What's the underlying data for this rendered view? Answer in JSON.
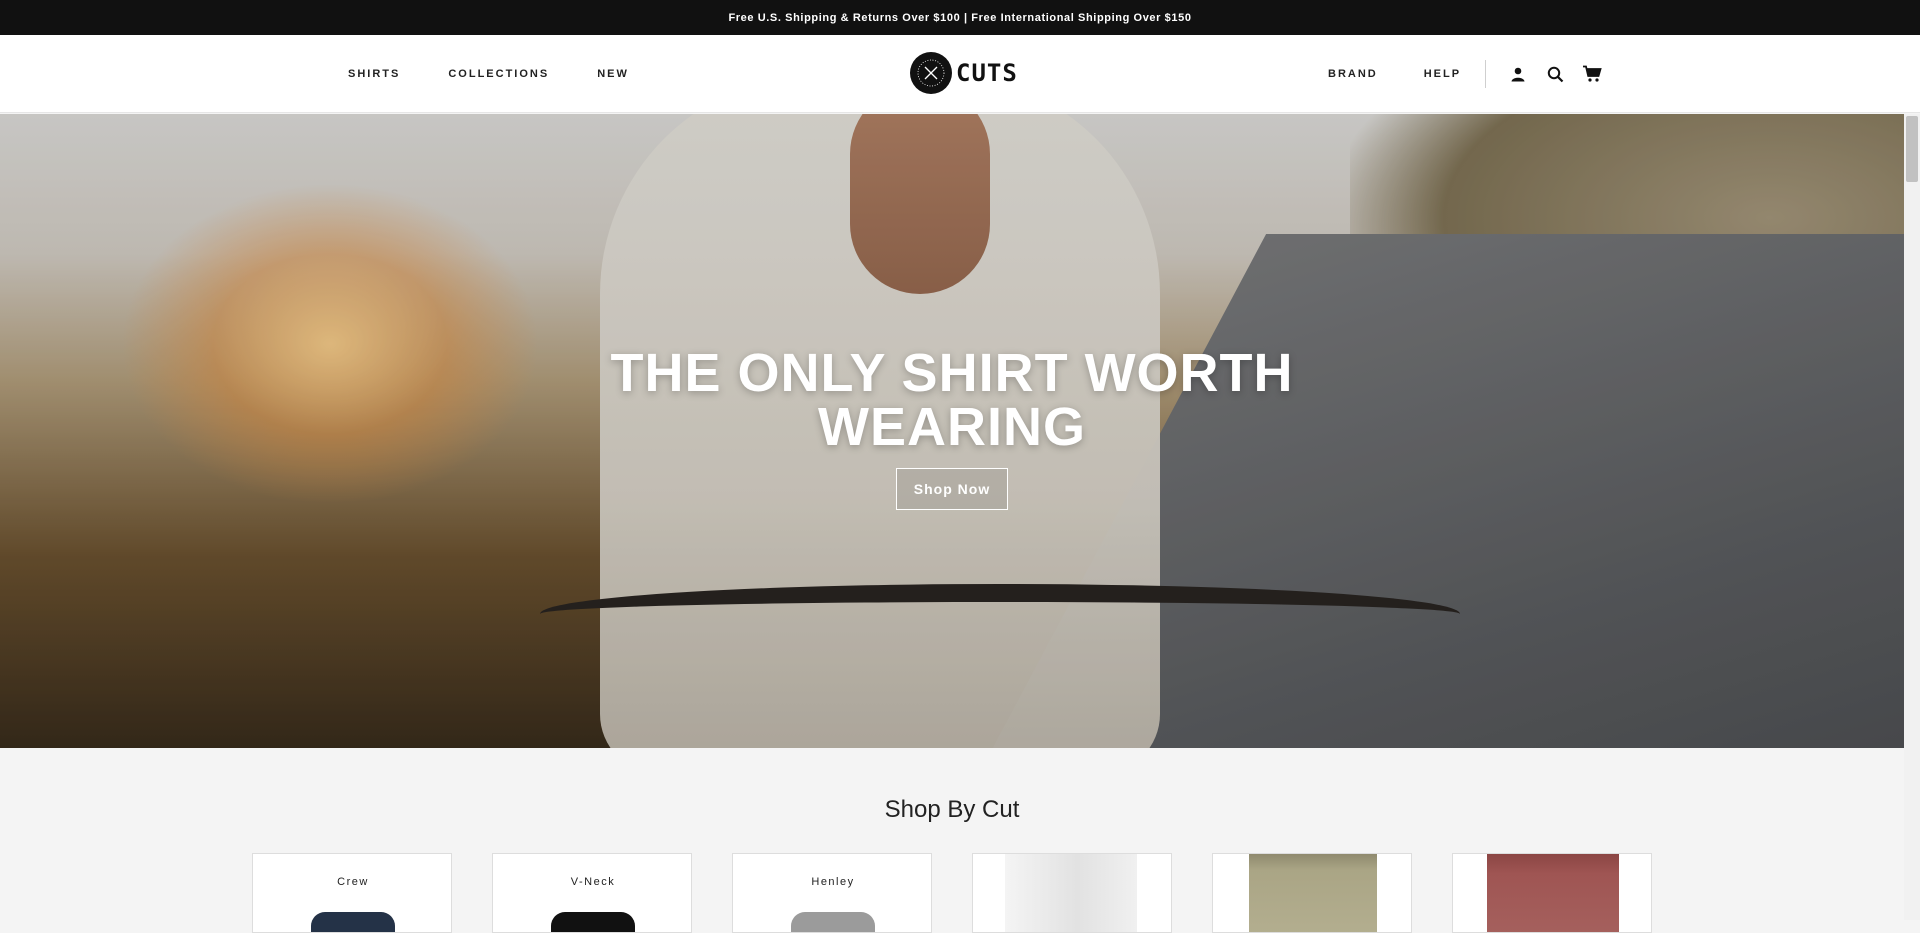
{
  "announcement": "Free U.S. Shipping & Returns Over $100 | Free International Shipping Over $150",
  "nav": {
    "left": [
      "SHIRTS",
      "COLLECTIONS",
      "NEW"
    ],
    "right": [
      "BRAND",
      "HELP"
    ],
    "icons": [
      "account-icon",
      "search-icon",
      "cart-icon"
    ]
  },
  "logo": {
    "text": "CUTS"
  },
  "hero": {
    "title_line1": "THE ONLY SHIRT WORTH",
    "title_line2": "WEARING",
    "cta": "Shop Now"
  },
  "section": {
    "title": "Shop By Cut"
  },
  "cuts": [
    {
      "label": "Crew",
      "color": "#243247"
    },
    {
      "label": "V-Neck",
      "color": "#111111"
    },
    {
      "label": "Henley",
      "color": "#9b9b9b"
    },
    {
      "label": "",
      "color": "#e9e9e9"
    },
    {
      "label": "",
      "color": "#aaa585"
    },
    {
      "label": "",
      "color": "#9f5553"
    }
  ]
}
